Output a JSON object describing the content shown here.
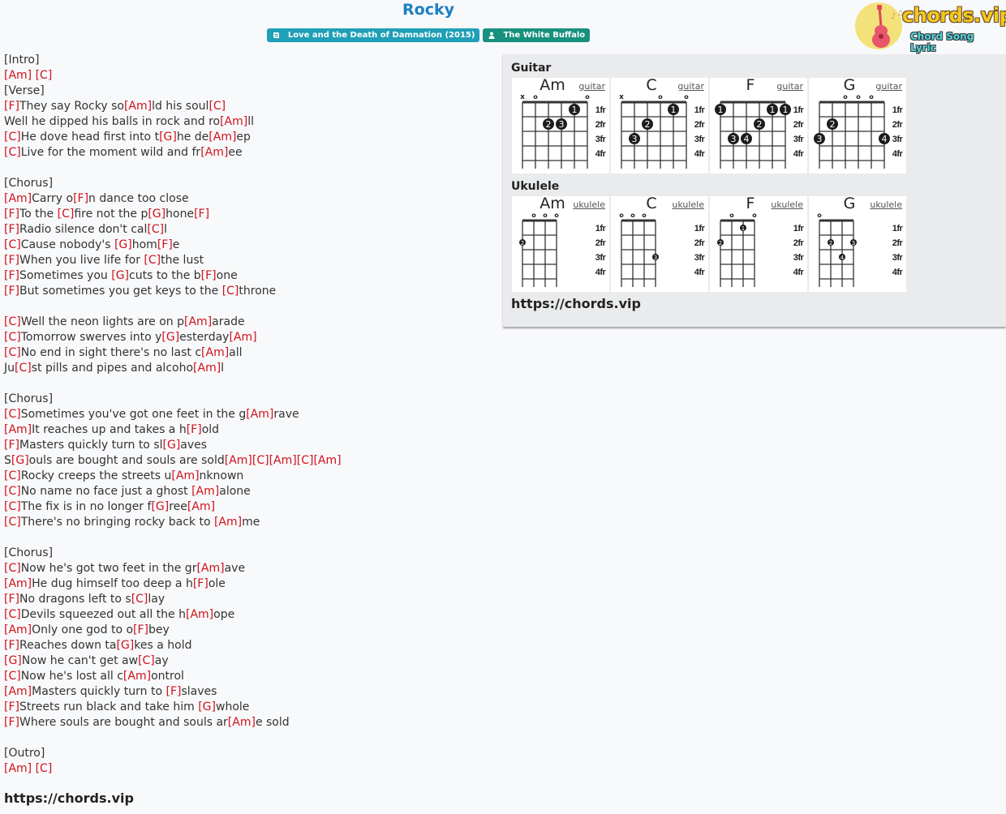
{
  "header": {
    "title": "Rocky",
    "album_badge": "Love and the Death of Damnation (2015)",
    "artist_badge": "The White Buffalo",
    "album_color": "#1f9fb8",
    "artist_color": "#17907e"
  },
  "logo": {
    "brand": "chords.vip",
    "tagline": "Chord Song Lyric"
  },
  "lyrics": [
    [
      {
        "t": "[Intro]"
      }
    ],
    [
      {
        "c": "[Am]"
      },
      {
        "t": " "
      },
      {
        "c": "[C]"
      }
    ],
    [
      {
        "t": "[Verse]"
      }
    ],
    [
      {
        "c": "[F]"
      },
      {
        "t": "They say Rocky so"
      },
      {
        "c": "[Am]"
      },
      {
        "t": "ld his soul"
      },
      {
        "c": "[C]"
      }
    ],
    [
      {
        "t": "Well he dipped his balls in rock and ro"
      },
      {
        "c": "[Am]"
      },
      {
        "t": "ll"
      }
    ],
    [
      {
        "c": "[C]"
      },
      {
        "t": "He dove head first into t"
      },
      {
        "c": "[G]"
      },
      {
        "t": "he de"
      },
      {
        "c": "[Am]"
      },
      {
        "t": "ep"
      }
    ],
    [
      {
        "c": "[C]"
      },
      {
        "t": "Live for the moment wild and fr"
      },
      {
        "c": "[Am]"
      },
      {
        "t": "ee"
      }
    ],
    [],
    [
      {
        "t": "[Chorus]"
      }
    ],
    [
      {
        "c": "[Am]"
      },
      {
        "t": "Carry o"
      },
      {
        "c": "[F]"
      },
      {
        "t": "n dance too close"
      }
    ],
    [
      {
        "c": "[F]"
      },
      {
        "t": "To the "
      },
      {
        "c": "[C]"
      },
      {
        "t": "fire not the p"
      },
      {
        "c": "[G]"
      },
      {
        "t": "hone"
      },
      {
        "c": "[F]"
      }
    ],
    [
      {
        "c": "[F]"
      },
      {
        "t": "Radio silence don't cal"
      },
      {
        "c": "[C]"
      },
      {
        "t": "l"
      }
    ],
    [
      {
        "c": "[C]"
      },
      {
        "t": "Cause nobody's "
      },
      {
        "c": "[G]"
      },
      {
        "t": "hom"
      },
      {
        "c": "[F]"
      },
      {
        "t": "e"
      }
    ],
    [
      {
        "c": "[F]"
      },
      {
        "t": "When you live life for "
      },
      {
        "c": "[C]"
      },
      {
        "t": "the lust"
      }
    ],
    [
      {
        "c": "[F]"
      },
      {
        "t": "Sometimes you "
      },
      {
        "c": "[G]"
      },
      {
        "t": "cuts to the b"
      },
      {
        "c": "[F]"
      },
      {
        "t": "one"
      }
    ],
    [
      {
        "c": "[F]"
      },
      {
        "t": "But sometimes you get keys to the "
      },
      {
        "c": "[C]"
      },
      {
        "t": "throne"
      }
    ],
    [],
    [
      {
        "c": "[C]"
      },
      {
        "t": "Well the neon lights are on p"
      },
      {
        "c": "[Am]"
      },
      {
        "t": "arade"
      }
    ],
    [
      {
        "c": "[C]"
      },
      {
        "t": "Tomorrow swerves into y"
      },
      {
        "c": "[G]"
      },
      {
        "t": "esterday"
      },
      {
        "c": "[Am]"
      }
    ],
    [
      {
        "c": "[C]"
      },
      {
        "t": "No end in sight there's no last c"
      },
      {
        "c": "[Am]"
      },
      {
        "t": "all"
      }
    ],
    [
      {
        "t": "Ju"
      },
      {
        "c": "[C]"
      },
      {
        "t": "st pills and pipes and alcoho"
      },
      {
        "c": "[Am]"
      },
      {
        "t": "l"
      }
    ],
    [],
    [
      {
        "t": "[Chorus]"
      }
    ],
    [
      {
        "c": "[C]"
      },
      {
        "t": "Sometimes you've got one feet in the g"
      },
      {
        "c": "[Am]"
      },
      {
        "t": "rave"
      }
    ],
    [
      {
        "c": "[Am]"
      },
      {
        "t": "It reaches up and takes a h"
      },
      {
        "c": "[F]"
      },
      {
        "t": "old"
      }
    ],
    [
      {
        "c": "[F]"
      },
      {
        "t": "Masters quickly turn to sl"
      },
      {
        "c": "[G]"
      },
      {
        "t": "aves"
      }
    ],
    [
      {
        "t": "S"
      },
      {
        "c": "[G]"
      },
      {
        "t": "ouls are bought and souls are sold"
      },
      {
        "c": "[Am]"
      },
      {
        "c": "[C]"
      },
      {
        "c": "[Am]"
      },
      {
        "c": "[C]"
      },
      {
        "c": "[Am]"
      }
    ],
    [
      {
        "c": "[C]"
      },
      {
        "t": "Rocky creeps the streets u"
      },
      {
        "c": "[Am]"
      },
      {
        "t": "nknown"
      }
    ],
    [
      {
        "c": "[C]"
      },
      {
        "t": "No name no face just a ghost "
      },
      {
        "c": "[Am]"
      },
      {
        "t": "alone"
      }
    ],
    [
      {
        "c": "[C]"
      },
      {
        "t": "The fix is in no longer f"
      },
      {
        "c": "[G]"
      },
      {
        "t": "ree"
      },
      {
        "c": "[Am]"
      }
    ],
    [
      {
        "c": "[C]"
      },
      {
        "t": "There's no bringing rocky back to "
      },
      {
        "c": "[Am]"
      },
      {
        "t": "me"
      }
    ],
    [],
    [
      {
        "t": "[Chorus]"
      }
    ],
    [
      {
        "c": "[C]"
      },
      {
        "t": "Now he's got two feet in the gr"
      },
      {
        "c": "[Am]"
      },
      {
        "t": "ave"
      }
    ],
    [
      {
        "c": "[Am]"
      },
      {
        "t": "He dug himself too deep a h"
      },
      {
        "c": "[F]"
      },
      {
        "t": "ole"
      }
    ],
    [
      {
        "c": "[F]"
      },
      {
        "t": "No dragons left to s"
      },
      {
        "c": "[C]"
      },
      {
        "t": "lay"
      }
    ],
    [
      {
        "c": "[C]"
      },
      {
        "t": "Devils squeezed out all the h"
      },
      {
        "c": "[Am]"
      },
      {
        "t": "ope"
      }
    ],
    [
      {
        "c": "[Am]"
      },
      {
        "t": "Only one god to o"
      },
      {
        "c": "[F]"
      },
      {
        "t": "bey"
      }
    ],
    [
      {
        "c": "[F]"
      },
      {
        "t": "Reaches down ta"
      },
      {
        "c": "[G]"
      },
      {
        "t": "kes a hold"
      }
    ],
    [
      {
        "c": "[G]"
      },
      {
        "t": "Now he can't get aw"
      },
      {
        "c": "[C]"
      },
      {
        "t": "ay"
      }
    ],
    [
      {
        "c": "[C]"
      },
      {
        "t": "Now he's lost all c"
      },
      {
        "c": "[Am]"
      },
      {
        "t": "ontrol"
      }
    ],
    [
      {
        "c": "[Am]"
      },
      {
        "t": "Masters quickly turn to "
      },
      {
        "c": "[F]"
      },
      {
        "t": "slaves"
      }
    ],
    [
      {
        "c": "[F]"
      },
      {
        "t": "Streets run black and take him "
      },
      {
        "c": "[G]"
      },
      {
        "t": "whole"
      }
    ],
    [
      {
        "c": "[F]"
      },
      {
        "t": "Where souls are bought and souls ar"
      },
      {
        "c": "[Am]"
      },
      {
        "t": "e sold"
      }
    ],
    [],
    [
      {
        "t": "[Outro]"
      }
    ],
    [
      {
        "c": "[Am]"
      },
      {
        "t": " "
      },
      {
        "c": "[C]"
      }
    ]
  ],
  "footer_url": "https://chords.vip",
  "chord_panel": {
    "guitar_heading": "Guitar",
    "ukulele_heading": "Ukulele",
    "url": "https://chords.vip",
    "fret_labels": [
      "1fr",
      "2fr",
      "3fr",
      "4fr"
    ],
    "guitar": [
      {
        "name": "Am",
        "link": "guitar",
        "markers": [
          "x",
          "o",
          "",
          "",
          "",
          "o"
        ],
        "dots": [
          {
            "s": 5,
            "f": 1,
            "n": "1"
          },
          {
            "s": 3,
            "f": 2,
            "n": "2"
          },
          {
            "s": 4,
            "f": 2,
            "n": "3"
          }
        ]
      },
      {
        "name": "C",
        "link": "guitar",
        "markers": [
          "x",
          "",
          "",
          "o",
          "",
          "o"
        ],
        "dots": [
          {
            "s": 5,
            "f": 1,
            "n": "1"
          },
          {
            "s": 3,
            "f": 2,
            "n": "2"
          },
          {
            "s": 2,
            "f": 3,
            "n": "3"
          }
        ]
      },
      {
        "name": "F",
        "link": "guitar",
        "markers": [
          "",
          "",
          "",
          "",
          "",
          ""
        ],
        "dots": [
          {
            "s": 1,
            "f": 1,
            "n": "1"
          },
          {
            "s": 5,
            "f": 1,
            "n": "1"
          },
          {
            "s": 6,
            "f": 1,
            "n": "1"
          },
          {
            "s": 4,
            "f": 2,
            "n": "2"
          },
          {
            "s": 2,
            "f": 3,
            "n": "3"
          },
          {
            "s": 3,
            "f": 3,
            "n": "4"
          }
        ]
      },
      {
        "name": "G",
        "link": "guitar",
        "markers": [
          "",
          "",
          "o",
          "o",
          "o",
          ""
        ],
        "dots": [
          {
            "s": 2,
            "f": 2,
            "n": "2"
          },
          {
            "s": 1,
            "f": 3,
            "n": "3"
          },
          {
            "s": 6,
            "f": 3,
            "n": "4"
          }
        ]
      }
    ],
    "ukulele": [
      {
        "name": "Am",
        "link": "ukulele",
        "markers": [
          "",
          "o",
          "o",
          "o"
        ],
        "dots": [
          {
            "s": 1,
            "f": 2,
            "n": "2"
          }
        ]
      },
      {
        "name": "C",
        "link": "ukulele",
        "markers": [
          "o",
          "o",
          "o",
          ""
        ],
        "dots": [
          {
            "s": 4,
            "f": 3,
            "n": "3"
          }
        ]
      },
      {
        "name": "F",
        "link": "ukulele",
        "markers": [
          "",
          "o",
          "",
          "o"
        ],
        "dots": [
          {
            "s": 3,
            "f": 1,
            "n": "1"
          },
          {
            "s": 1,
            "f": 2,
            "n": "2"
          }
        ]
      },
      {
        "name": "G",
        "link": "ukulele",
        "markers": [
          "o",
          "",
          "",
          ""
        ],
        "dots": [
          {
            "s": 2,
            "f": 2,
            "n": "2"
          },
          {
            "s": 4,
            "f": 2,
            "n": "3"
          },
          {
            "s": 3,
            "f": 3,
            "n": "4"
          }
        ]
      }
    ]
  }
}
